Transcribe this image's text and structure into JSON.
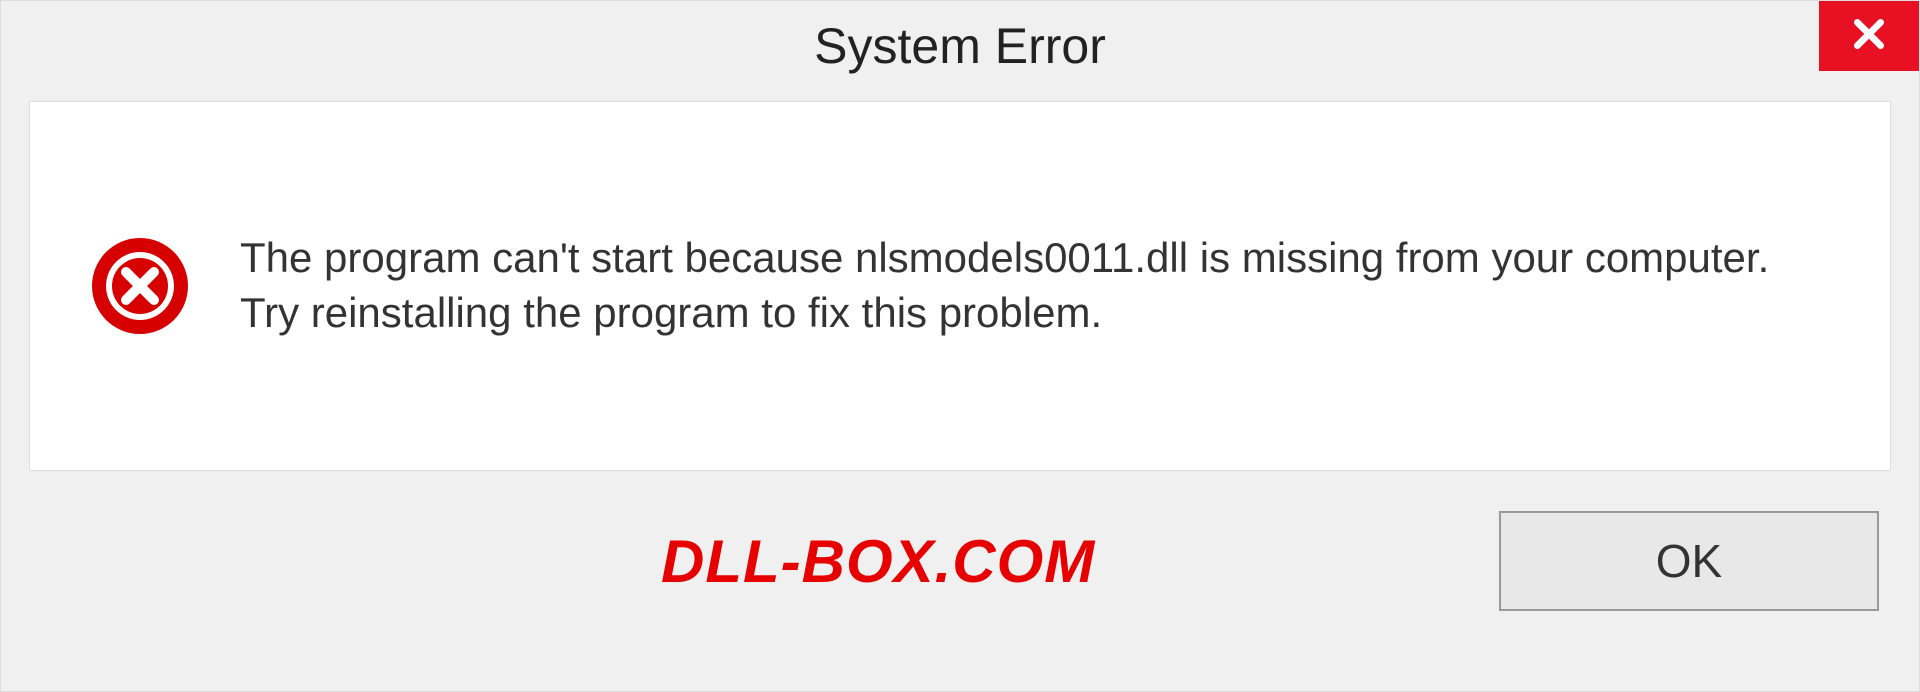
{
  "titlebar": {
    "title": "System Error"
  },
  "dialog": {
    "message": "The program can't start because nlsmodels0011.dll is missing from your computer. Try reinstalling the program to fix this problem."
  },
  "footer": {
    "watermark": "DLL-BOX.COM",
    "ok_label": "OK"
  }
}
